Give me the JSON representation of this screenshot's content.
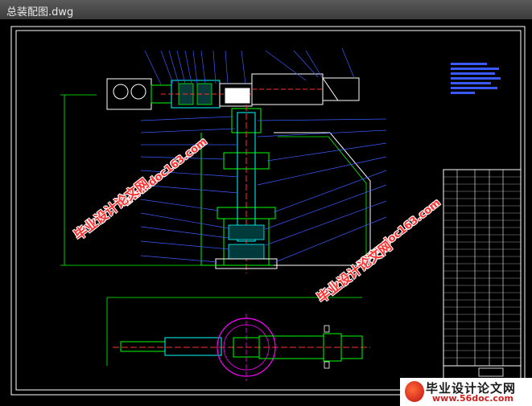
{
  "window": {
    "title": "总装配图.dwg"
  },
  "watermarks": {
    "site_name": "毕业设计论文网",
    "site_url": "www.doc163.com"
  },
  "brand": {
    "name": "毕业设计论文网",
    "url": "www.56doc.com",
    "logo": "flame-logo-icon"
  },
  "colors": {
    "background": "#000000",
    "frame": "#ffffff",
    "outline": "#00ff00",
    "leader": "#3a5aff",
    "detail": "#00ffff",
    "accent": "#ff3030",
    "center": "#ff00ff"
  }
}
